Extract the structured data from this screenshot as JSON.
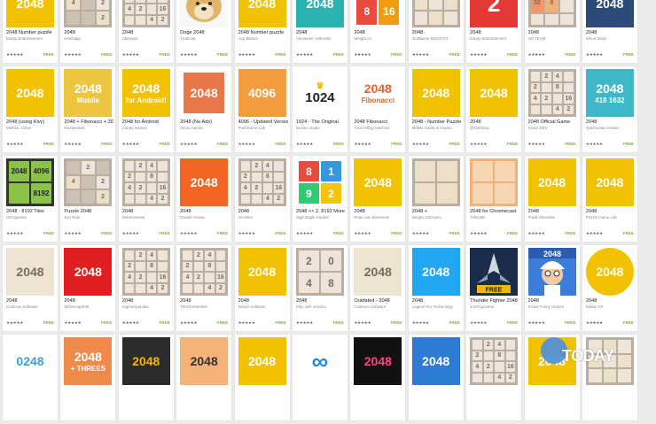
{
  "rows": [
    [
      {
        "title": "2048 Number puzzle",
        "dev": "Estoty Entertainment",
        "stars": "★★★★★",
        "free": "FREE",
        "icon": "yellow-2048-icon",
        "text": "2048",
        "bg": "#f2c200",
        "fg": "#ffffff"
      },
      {
        "title": "2048",
        "dev": "Ketchapp",
        "stars": "★★★★★",
        "free": "FREE",
        "icon": "gray-tile-grid-icon",
        "tiles": "gray"
      },
      {
        "title": "2048",
        "dev": "Uberspot",
        "stars": "★★★★★",
        "free": "FREE",
        "icon": "numbered-tile-grid-icon",
        "tiles": "light"
      },
      {
        "title": "Doge 2048",
        "dev": "Ticalcula",
        "stars": "★★★★★",
        "free": "FREE",
        "icon": "doge-dog-icon",
        "doge": true
      },
      {
        "title": "2048 Number puzzle",
        "dev": "App Blaster",
        "stars": "★★★★★",
        "free": "FREE",
        "icon": "yellow-2048-icon",
        "text": "2048",
        "bg": "#f2c200",
        "fg": "#ffffff"
      },
      {
        "title": "2048",
        "dev": "Alexander Volkovski",
        "stars": "★★★★★",
        "free": "FREE",
        "icon": "teal-2048-icon",
        "text": "2048",
        "bg": "#2ab3b1",
        "fg": "#ffffff"
      },
      {
        "title": "2048",
        "dev": "Weight.on",
        "stars": "★★★★★",
        "free": "FREE",
        "icon": "colored-tiles-icon",
        "tiles": "color816"
      },
      {
        "title": "2048",
        "dev": "Guillaume BOUSTAT",
        "stars": "★★★★★",
        "free": "FREE",
        "icon": "beige-tile-grid-icon",
        "tiles": "beige"
      },
      {
        "title": "2048",
        "dev": "Estoty Entertainment",
        "stars": "★★★★★",
        "free": "FREE",
        "icon": "red-2-power-icon",
        "text": "2",
        "bg": "#e53935",
        "fg": "#ffffff"
      },
      {
        "title": "2048",
        "dev": "NO TEAM",
        "stars": "★★★★★",
        "free": "FREE",
        "icon": "orange-tile-grid-icon",
        "tiles": "tiles328"
      },
      {
        "title": "2048",
        "dev": "Shine Dead",
        "stars": "★★★★★",
        "free": "FREE",
        "icon": "navy-2048-icon",
        "text": "2048",
        "bg": "#2c4a7a",
        "fg": "#ffffff"
      }
    ],
    [
      {
        "title": "2048 (using Kivy)",
        "dev": "Mathieu Virbel",
        "stars": "★★★★★",
        "free": "FREE",
        "icon": "yellow-kivy-2048-icon",
        "text": "2048",
        "bg": "#f2c200",
        "fg": "#ffffff"
      },
      {
        "title": "2048 + Fibonacci + 3D",
        "dev": "Numberkids",
        "stars": "★★★★★",
        "free": "FREE",
        "icon": "mobile-2048-icon",
        "text": "2048",
        "sub": "Mobile",
        "bg": "#edc53f",
        "fg": "#ffffff"
      },
      {
        "title": "2048 for Android",
        "dev": "Candy Games",
        "stars": "★★★★★",
        "free": "FREE",
        "icon": "android-2048-icon",
        "text": "2048",
        "sub": "for Android!",
        "bg": "#f2c200",
        "fg": "#ffffff"
      },
      {
        "title": "2048 (No Ads)",
        "dev": "Sirius Games",
        "stars": "★★★★★",
        "free": "FREE",
        "icon": "orange-frame-2048-icon",
        "text": "2048",
        "bg": "#e8774a",
        "fg": "#ffffff",
        "frame": true
      },
      {
        "title": "4096 - Updated Version",
        "dev": "PushGame Lab",
        "stars": "★★★★★",
        "free": "FREE",
        "icon": "orange-4096-icon",
        "text": "4096",
        "bg": "#f39c3d",
        "fg": "#ffffff"
      },
      {
        "title": "1024 - The Original",
        "dev": "weewo studio",
        "stars": "★★★★★",
        "free": "FREE",
        "icon": "crown-1024-icon",
        "text": "1024",
        "bg": "#ffffff",
        "fg": "#222222",
        "crown": true
      },
      {
        "title": "2048 Fibonacci",
        "dev": "Time Killing Machine",
        "stars": "★★★★★",
        "free": "FREE",
        "icon": "fibonacci-2048-icon",
        "text": "2048",
        "sub": "Fibonacci",
        "bg": "#ffffff",
        "fg": "#e8632b"
      },
      {
        "title": "2048 - Number Puzzle",
        "dev": "Mobile Cards & Casino",
        "stars": "★★★★★",
        "free": "FREE",
        "icon": "yellow-rounded-2048-icon",
        "text": "2048",
        "bg": "#f2c200",
        "fg": "#ffffff"
      },
      {
        "title": "2048",
        "dev": "@Hold2Up",
        "stars": "★★★★★",
        "free": "FREE",
        "icon": "yellow-2048-icon",
        "text": "2048",
        "bg": "#f2c200",
        "fg": "#ffffff"
      },
      {
        "title": "2048 Official Game",
        "dev": "Smart DEV",
        "stars": "★★★★★",
        "free": "FREE",
        "icon": "small-tile-grid-icon",
        "tiles": "light"
      },
      {
        "title": "2048",
        "dev": "Vyacheslav Kiselev",
        "stars": "★★★★★",
        "free": "FREE",
        "icon": "teal-numbers-grid-icon",
        "text": "2048",
        "sub": "418 1632",
        "bg": "#3fb8c9",
        "fg": "#ffffff"
      }
    ],
    [
      {
        "title": "2048 - 8192 Tiles",
        "dev": "UKOgames",
        "stars": "★★★★★",
        "free": "FREE",
        "icon": "green-tiles-icon",
        "tiles": "green"
      },
      {
        "title": "Puzzle 2048",
        "dev": "Syn Rain",
        "stars": "★★★★★",
        "free": "FREE",
        "icon": "gray-tile-grid-icon",
        "tiles": "gray"
      },
      {
        "title": "2048",
        "dev": "DeloFenDew",
        "stars": "★★★★★",
        "free": "FREE",
        "icon": "numbered-tile-grid-icon",
        "tiles": "light"
      },
      {
        "title": "2048",
        "dev": "Davide Gessa",
        "stars": "★★★★★",
        "free": "FREE",
        "icon": "orange-2048-icon",
        "text": "2048",
        "bg": "#f26522",
        "fg": "#ffffff"
      },
      {
        "title": "2048",
        "dev": "An artist",
        "stars": "★★★★★",
        "free": "FREE",
        "icon": "numbered-tile-grid-icon",
        "tiles": "light"
      },
      {
        "title": "2048 << 2, 8192 More",
        "dev": "High Eagle Studios",
        "stars": "★★★★★",
        "free": "FREE",
        "icon": "colored-8192-icon",
        "tiles": "c8192"
      },
      {
        "title": "2048",
        "dev": "Peter-Jan Beesmeer",
        "stars": "★★★★★",
        "free": "FREE",
        "icon": "yellow-2048-icon",
        "text": "2048",
        "bg": "#f2c200",
        "fg": "#ffffff"
      },
      {
        "title": "2048 +",
        "dev": "Sergey Solovyev",
        "stars": "★★★★★",
        "free": "FREE",
        "icon": "brown-tile-grid-icon",
        "tiles": "brown"
      },
      {
        "title": "2048 for Chromecast",
        "dev": "TofuLittle",
        "stars": "★★★★★",
        "free": "FREE",
        "icon": "peach-tile-grid-icon",
        "tiles": "peach"
      },
      {
        "title": "2048",
        "dev": "Pratik Shrestha",
        "stars": "★★★★★",
        "free": "FREE",
        "icon": "yellow-2048-icon",
        "text": "2048",
        "bg": "#f2c200",
        "fg": "#ffffff"
      },
      {
        "title": "2048",
        "dev": "Puzzle Game Lab",
        "stars": "★★★★★",
        "free": "FREE",
        "icon": "yellow-2048-icon",
        "text": "2048",
        "bg": "#f2c200",
        "fg": "#ffffff"
      }
    ],
    [
      {
        "title": "2048",
        "dev": "Codesus Software",
        "stars": "★★★★★",
        "free": "FREE",
        "icon": "beige-rounded-2048-icon",
        "text": "2048",
        "bg": "#efe3d3",
        "fg": "#7a6b5b"
      },
      {
        "title": "2048",
        "dev": "WhatsAppSoft",
        "stars": "★★★★★",
        "free": "FREE",
        "icon": "red-2048-icon",
        "text": "2048",
        "bg": "#e02020",
        "fg": "#ffffff"
      },
      {
        "title": "2048",
        "dev": "SigmaAppLabs",
        "stars": "★★★★★",
        "free": "FREE",
        "icon": "numbered-tile-grid-icon",
        "tiles": "light"
      },
      {
        "title": "2048",
        "dev": "TheOhmWorker",
        "stars": "★★★★★",
        "free": "FREE",
        "icon": "numbered-tile-grid-icon",
        "tiles": "light"
      },
      {
        "title": "2048",
        "dev": "Sivium software",
        "stars": "★★★★★",
        "free": "FREE",
        "icon": "yellow-2048-icon",
        "text": "2048",
        "bg": "#f2c200",
        "fg": "#ffffff"
      },
      {
        "title": "2048",
        "dev": "Play with Voodoo",
        "stars": "★★★★★",
        "free": "FREE",
        "icon": "beige-2048-tiles-icon",
        "tiles": "t2048"
      },
      {
        "title": "Outdated - 2048",
        "dev": "Codesus Software",
        "stars": "★★★★★",
        "free": "FREE",
        "icon": "beige-rounded-2048-icon",
        "text": "2048",
        "bg": "#efe3d3",
        "fg": "#7a6b5b"
      },
      {
        "title": "2048",
        "dev": "Legend Pro Technology",
        "stars": "★★★★★",
        "free": "FREE",
        "icon": "blue-2048-icon",
        "text": "2048",
        "bg": "#22a7f0",
        "fg": "#ffffff"
      },
      {
        "title": "Thunder Fighter 2048",
        "dev": "JustTopGame",
        "stars": "★★★★★",
        "free": "FREE",
        "icon": "spaceship-icon",
        "ship": true
      },
      {
        "title": "2048",
        "dev": "Smart Funny Games",
        "stars": "★★★★★",
        "free": "FREE",
        "icon": "cartoon-scientist-icon",
        "sci": true
      },
      {
        "title": "2048",
        "dev": "Rahul A R",
        "stars": "★★★★★",
        "free": "FREE",
        "icon": "yellow-circle-2048-icon",
        "text": "2048",
        "bg": "#f2c200",
        "fg": "#ffffff",
        "circle": true
      }
    ],
    [
      {
        "icon": "colorful-0248-icon",
        "text": "0248",
        "bg": "#ffffff",
        "fg": "#3fa0d8"
      },
      {
        "icon": "threes-2048-icon",
        "text": "2048",
        "sub": "+ THREES",
        "bg": "#f08a4b",
        "fg": "#ffffff"
      },
      {
        "icon": "dark-2048-icon",
        "text": "2048",
        "bg": "#2c2c2c",
        "fg": "#f5b800"
      },
      {
        "icon": "orange-tiles-2048-icon",
        "text": "2048",
        "bg": "#f5b37a",
        "fg": "#333333"
      },
      {
        "icon": "yellow-tile-grid-icon",
        "text": "2048",
        "bg": "#f2c200",
        "fg": "#ffffff"
      },
      {
        "icon": "infinity-icon",
        "text": "∞",
        "bg": "#ffffff",
        "fg": "#1e88e5"
      },
      {
        "icon": "pixel-2048-icon",
        "text": "2048",
        "bg": "#111111",
        "fg": "#ff4081"
      },
      {
        "icon": "candy-2048-icon",
        "text": "2048",
        "bg": "#2e7bd6",
        "fg": "#ffffff"
      },
      {
        "icon": "light-tile-grid-icon",
        "tiles": "light"
      },
      {
        "icon": "yellow-2048-icon",
        "text": "2048",
        "bg": "#f2c200",
        "fg": "#ffffff"
      },
      {
        "icon": "beige-tile-grid-icon",
        "tiles": "beige"
      }
    ]
  ],
  "watermark": {
    "text": "TODAY",
    "color": "#4a90e2"
  }
}
